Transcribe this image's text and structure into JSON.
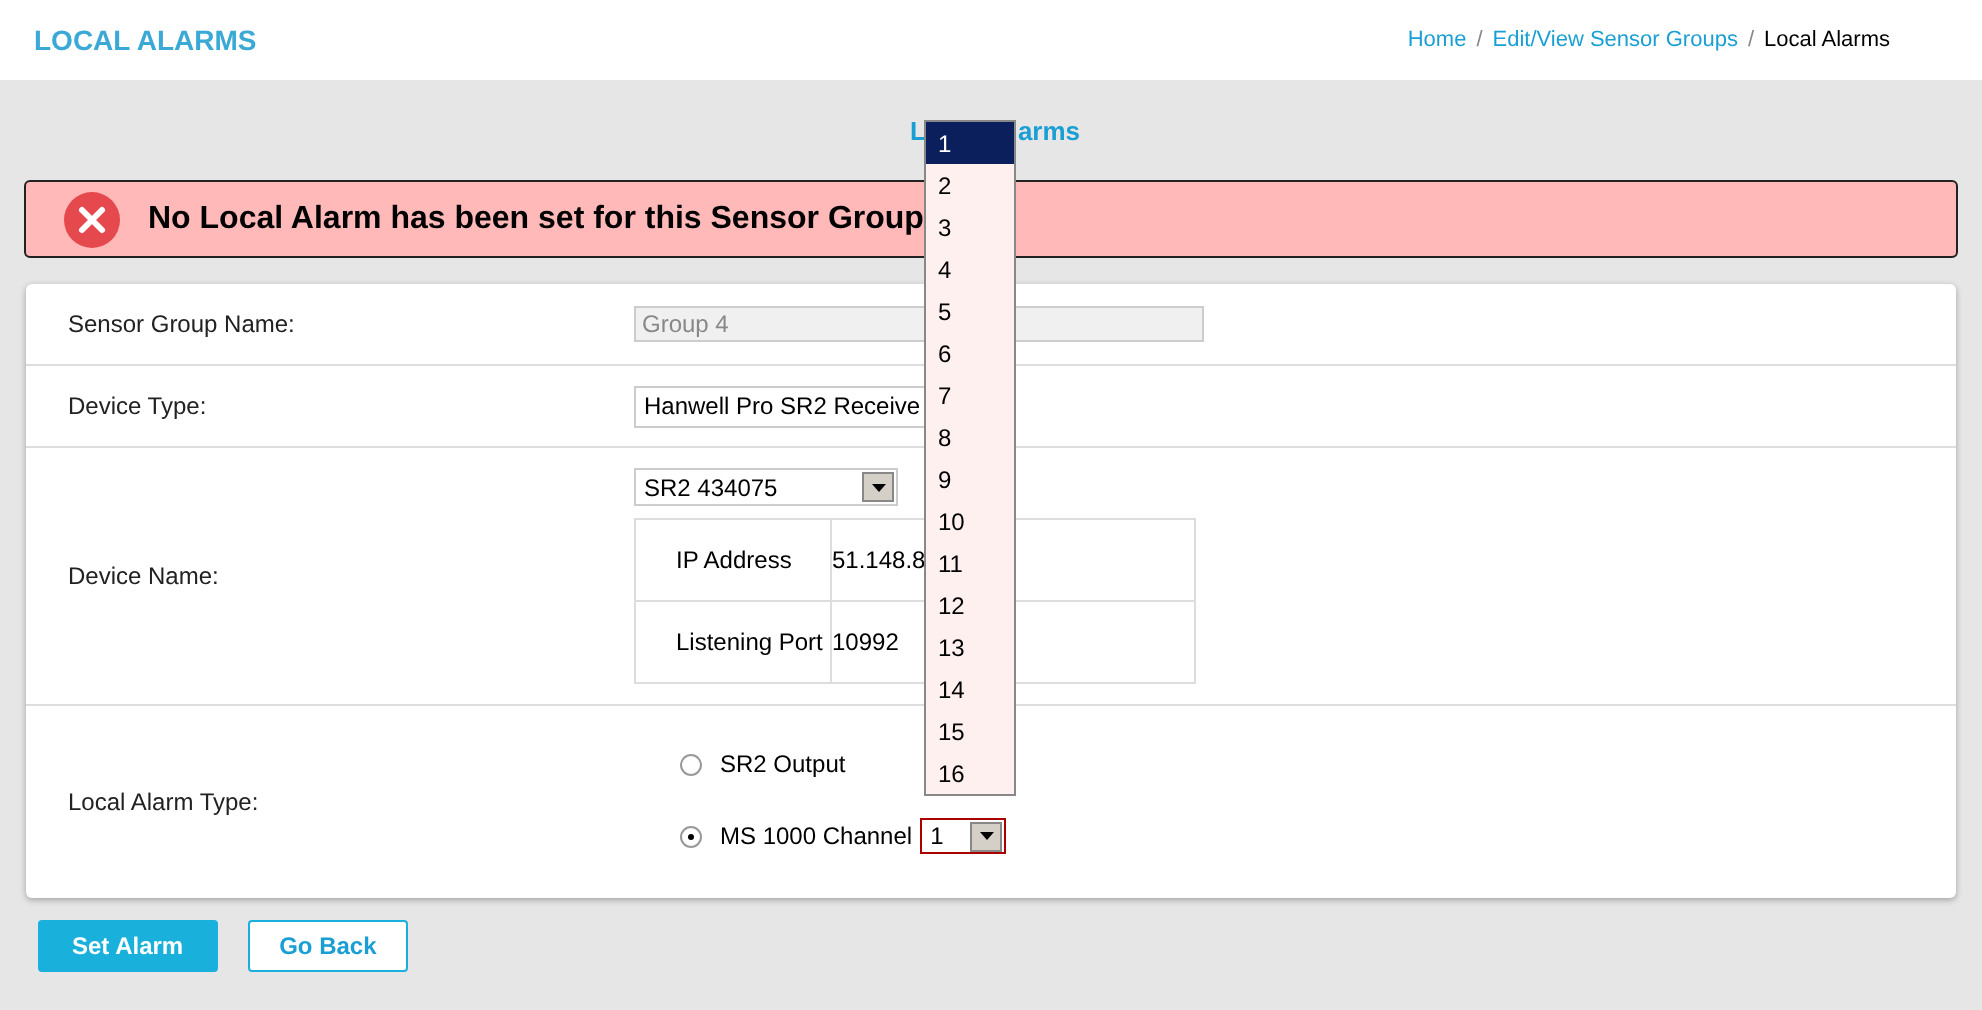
{
  "header": {
    "title": "LOCAL ALARMS",
    "breadcrumb": [
      {
        "label": "Home",
        "current": false,
        "separator": "/"
      },
      {
        "label": "Edit/View Sensor Groups",
        "current": false,
        "separator": "/"
      },
      {
        "label": "Local Alarms",
        "current": true
      }
    ]
  },
  "page_title": {
    "visible_parts": [
      "L",
      "arms"
    ]
  },
  "alert": {
    "message": "No Local Alarm has been set for this Sensor Group"
  },
  "form": {
    "sensor_group_name": {
      "label": "Sensor Group Name:",
      "value": "Group 4",
      "disabled": true
    },
    "device_type": {
      "label": "Device Type:",
      "value": "Hanwell Pro SR2 Receive"
    },
    "device_name": {
      "label": "Device Name:",
      "value": "SR2 434075",
      "details": [
        {
          "label": "IP Address",
          "value": "51.148.8"
        },
        {
          "label": "Listening Port",
          "value": "10992"
        }
      ]
    },
    "alarm_type": {
      "label": "Local Alarm Type:",
      "options": [
        {
          "label": "SR2 Output",
          "selected": false
        },
        {
          "label": "MS 1000 Channel",
          "selected": true
        }
      ],
      "channel": "1"
    }
  },
  "channel_dropdown": {
    "options": [
      {
        "label": "1",
        "selected": true
      },
      {
        "label": "2",
        "selected": false
      },
      {
        "label": "3",
        "selected": false
      },
      {
        "label": "4",
        "selected": false
      },
      {
        "label": "5",
        "selected": false
      },
      {
        "label": "6",
        "selected": false
      },
      {
        "label": "7",
        "selected": false
      },
      {
        "label": "8",
        "selected": false
      },
      {
        "label": "9",
        "selected": false
      },
      {
        "label": "10",
        "selected": false
      },
      {
        "label": "11",
        "selected": false
      },
      {
        "label": "12",
        "selected": false
      },
      {
        "label": "13",
        "selected": false
      },
      {
        "label": "14",
        "selected": false
      },
      {
        "label": "15",
        "selected": false
      },
      {
        "label": "16",
        "selected": false
      }
    ]
  },
  "buttons": [
    {
      "label": "Set Alarm",
      "kind": "primary"
    },
    {
      "label": "Go Back",
      "kind": "secondary"
    }
  ]
}
